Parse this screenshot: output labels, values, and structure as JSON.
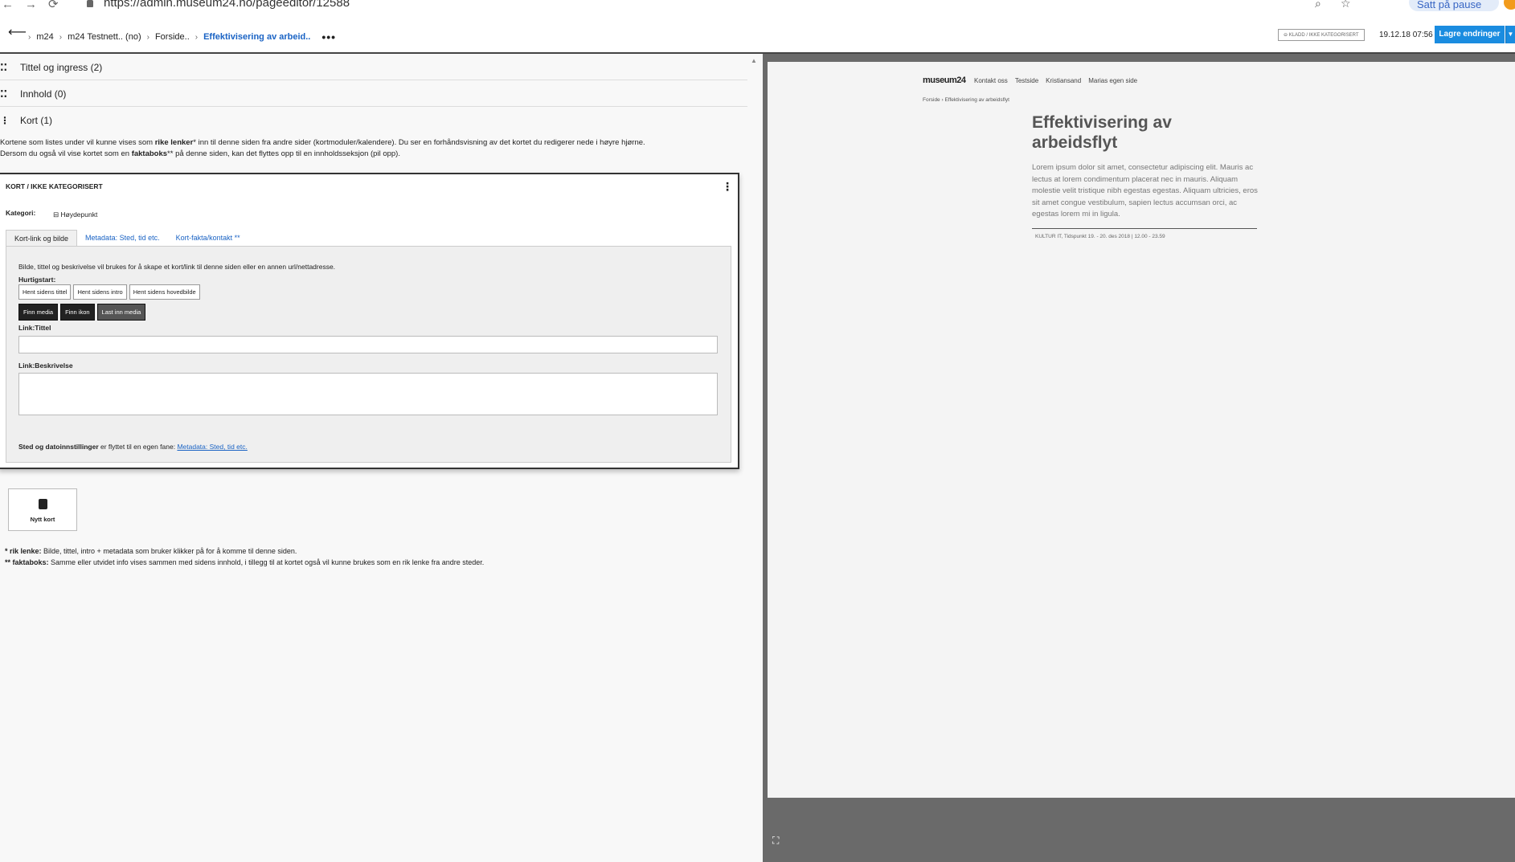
{
  "browser": {
    "url": "https://admin.museum24.no/pageeditor/12588",
    "pause_label": "Satt på pause"
  },
  "header": {
    "crumbs": [
      "m24",
      "m24 Testnett.. (no)",
      "Forside..",
      "Effektivisering av arbeid.."
    ],
    "draft_badge": "⊖ KLADD / IKKE KATEGORISERT",
    "date": "19.12.18 07:56",
    "save_label": "Lagre endringer"
  },
  "sections": [
    {
      "label": "Tittel og ingress (2)"
    },
    {
      "label": "Innhold (0)"
    },
    {
      "label": "Kort (1)"
    }
  ],
  "help": {
    "line1_a": "Kortene som listes under vil kunne vises som ",
    "line1_b": "rike lenker",
    "line1_c": "* inn til denne siden fra andre sider (kortmoduler/kalendere). Du ser en forhåndsvisning av det kortet du redigerer nede i høyre hjørne.",
    "line2_a": "Dersom du også vil vise kortet som en ",
    "line2_b": "faktaboks",
    "line2_c": "** på denne siden, kan det flyttes opp til en innholdsseksjon (pil opp)."
  },
  "card": {
    "title": "KORT / IKKE KATEGORISERT",
    "category_label": "Kategori:",
    "category_value": "Høydepunkt",
    "tabs": [
      "Kort-link og bilde",
      "Metadata: Sted, tid etc.",
      "Kort-fakta/kontakt **"
    ],
    "intro": "Bilde, tittel og beskrivelse vil brukes for å skape et kort/link til denne siden eller en annen url/nettadresse.",
    "quickstart_label": "Hurtigstart:",
    "quick_buttons": [
      "Hent sidens tittel",
      "Hent sidens intro",
      "Hent sidens hovedbilde"
    ],
    "media_buttons": [
      "Finn media",
      "Finn ikon",
      "Last inn media"
    ],
    "link_title_label": "Link:Tittel",
    "link_desc_label": "Link:Beskrivelse",
    "note_a": "Sted og datoinnstillinger",
    "note_b": " er flyttet til en egen fane: ",
    "note_link": "Metadata: Sted, tid etc."
  },
  "new_card_label": "Nytt kort",
  "footnotes": {
    "f1_b": "* rik lenke:",
    "f1": " Bilde, tittel, intro + metadata som bruker klikker på for å komme til denne siden.",
    "f2_b": "** faktaboks:",
    "f2": " Samme eller utvidet info vises sammen med sidens innhold, i tillegg til at kortet også vil kunne brukes som en rik lenke fra andre steder."
  },
  "preview": {
    "logo": "museum24",
    "nav": [
      "Kontakt oss",
      "Testside",
      "Kristiansand",
      "Marias egen side"
    ],
    "crumb_a": "Forside",
    "crumb_b": "Effektivisering av arbeidsflyt",
    "title": "Effektivisering av arbeidsflyt",
    "text": "Lorem ipsum dolor sit amet, consectetur adipiscing elit. Mauris ac lectus at lorem condimentum placerat nec in mauris. Aliquam molestie velit tristique nibh egestas egestas. Aliquam ultricies, eros sit amet congue vestibulum, sapien lectus accumsan orci, ac egestas lorem mi in ligula.",
    "meta": "KULTUR IT, Tidspunkt 19. - 20. des 2018 | 12.00 - 23.59"
  },
  "colors": {
    "accent": "#1a8ce0",
    "link": "#1a63c4"
  }
}
